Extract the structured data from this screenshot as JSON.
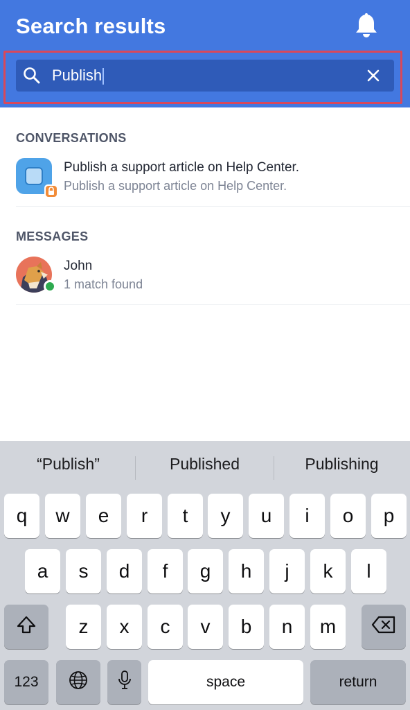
{
  "header": {
    "title": "Search results"
  },
  "search": {
    "value": "Publish"
  },
  "sections": {
    "conversations": {
      "title": "CONVERSATIONS",
      "items": [
        {
          "title": "Publish a support article on Help Center.",
          "subtitle": "Publish a support article on Help Center."
        }
      ]
    },
    "messages": {
      "title": "MESSAGES",
      "items": [
        {
          "title": "John",
          "subtitle": "1 match found"
        }
      ]
    }
  },
  "keyboard": {
    "suggestions": [
      "“Publish”",
      "Published",
      "Publishing"
    ],
    "row1": [
      "q",
      "w",
      "e",
      "r",
      "t",
      "y",
      "u",
      "i",
      "o",
      "p"
    ],
    "row2": [
      "a",
      "s",
      "d",
      "f",
      "g",
      "h",
      "j",
      "k",
      "l"
    ],
    "row3": [
      "z",
      "x",
      "c",
      "v",
      "b",
      "n",
      "m"
    ],
    "numbers_label": "123",
    "space_label": "space",
    "return_label": "return"
  },
  "colors": {
    "header": "#4378e0",
    "search_field": "#2f5bb8",
    "highlight_frame": "#d9485b",
    "online": "#2eaa4f",
    "lock_badge": "#f28c38"
  },
  "icons": {
    "notifications": "bell-icon",
    "search": "search-icon",
    "clear": "close-icon",
    "shift": "shift-icon",
    "delete": "backspace-icon",
    "globe": "globe-icon",
    "mic": "microphone-icon"
  }
}
